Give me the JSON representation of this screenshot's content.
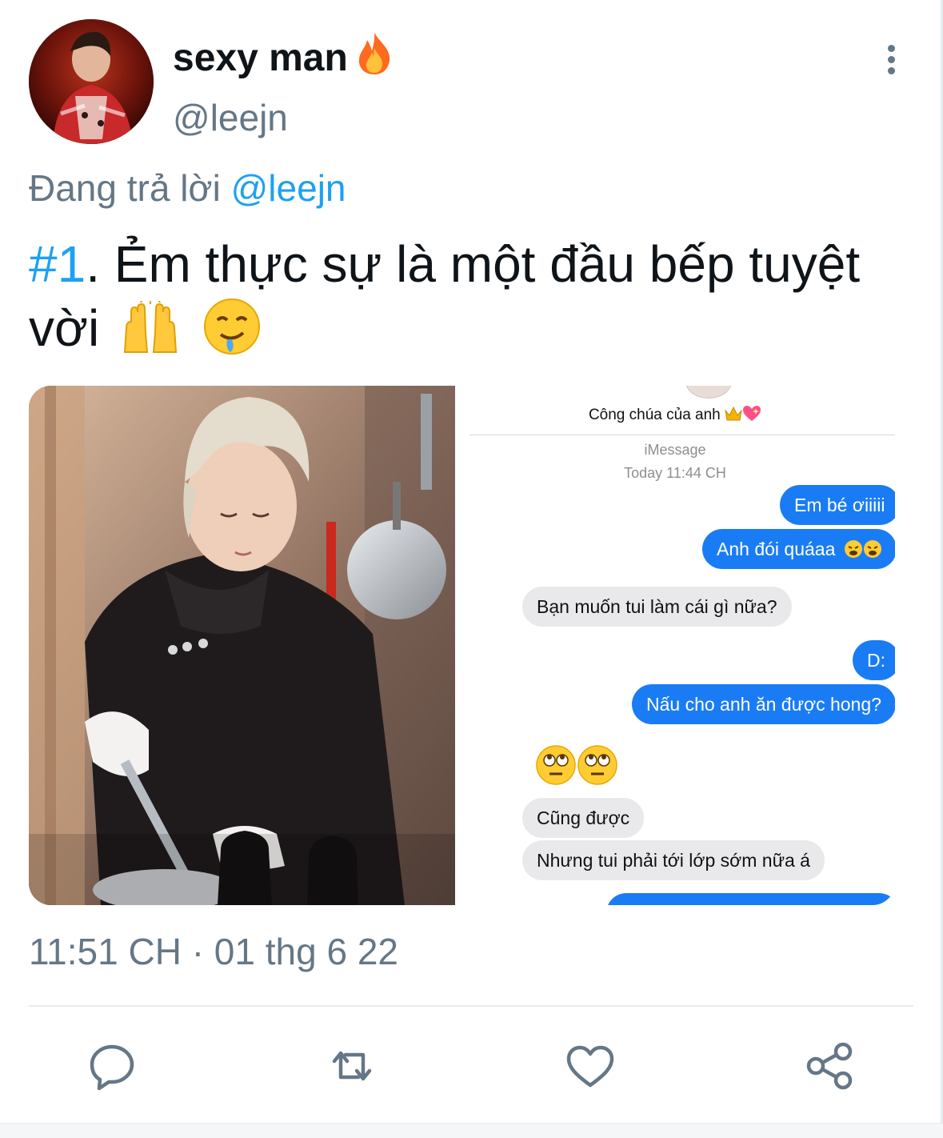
{
  "tweet": {
    "display_name": "sexy man",
    "name_emoji": "fire-emoji",
    "handle": "@leejn",
    "more_icon": "more-vertical-icon",
    "reply_prefix": "Đang trả lời",
    "reply_to": "@leejn",
    "hashtag": "#1",
    "text_line1": ". Ẻm thực sự là một đầu bếp tuyệt",
    "text_line2": "vời",
    "text_emojis": [
      "raising-hands-emoji",
      "drooling-face-emoji"
    ],
    "timestamp": "11:51 CH · 01 thg 6 22"
  },
  "media": {
    "photo": "person-cooking-in-kitchen-photo",
    "chat": {
      "contact_name": "Công chúa của anh",
      "contact_emojis": [
        "crown-emoji",
        "sparkling-heart-emoji"
      ],
      "service": "iMessage",
      "time": "Today 11:44 CH",
      "messages": [
        {
          "side": "out",
          "text": "Em bé ơiiiii"
        },
        {
          "side": "out",
          "text": "Anh đói quáaa",
          "emojis": [
            "weary-face-emoji",
            "weary-face-emoji"
          ]
        },
        {
          "side": "in",
          "text": "Bạn muốn tui làm cái gì nữa?"
        },
        {
          "side": "out",
          "text": "D:"
        },
        {
          "side": "out",
          "text": "Nấu cho anh ăn được hong?"
        },
        {
          "side": "in",
          "text": "",
          "emojis": [
            "eye-roll-emoji",
            "eye-roll-emoji"
          ]
        },
        {
          "side": "in",
          "text": "Cũng được"
        },
        {
          "side": "in",
          "text": "Nhưng tui phải tới lớp sớm nữa á"
        }
      ]
    }
  },
  "actions": [
    {
      "name": "reply-button",
      "icon": "reply-icon"
    },
    {
      "name": "retweet-button",
      "icon": "retweet-icon"
    },
    {
      "name": "like-button",
      "icon": "heart-icon"
    },
    {
      "name": "share-button",
      "icon": "share-icon"
    }
  ],
  "colors": {
    "link": "#1da1f2",
    "secondary_text": "#657786",
    "imessage_blue": "#1a7cf5",
    "imessage_gray": "#e9e9eb"
  }
}
